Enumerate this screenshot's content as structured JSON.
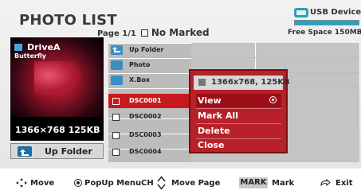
{
  "screen": {
    "title": "PHOTO LIST",
    "page_label": "Page 1/1",
    "marked_label": "No Marked"
  },
  "device": {
    "name": "USB Device",
    "free_space": "Free Space 150MB",
    "icon": "usb-drive-icon",
    "accent": "#1da5c4"
  },
  "preview": {
    "drive_name": "DriveA",
    "file_name": "Butterfly",
    "resolution_size": "1366×768  125KB"
  },
  "up_folder_button": {
    "label": "Up Folder",
    "icon": "up-folder-icon"
  },
  "file_list": {
    "items": [
      {
        "label": "Up Folder",
        "type": "folder-up",
        "icon": "up-folder-icon"
      },
      {
        "label": "Photo",
        "type": "folder",
        "icon": "folder-icon"
      },
      {
        "label": "X.Box",
        "type": "folder",
        "icon": "folder-icon"
      },
      {
        "label": "DSC0001",
        "type": "file",
        "icon": "checkbox-icon",
        "selected": true
      },
      {
        "label": "DSC0002",
        "type": "file",
        "icon": "checkbox-icon"
      },
      {
        "label": "DSC0003",
        "type": "file",
        "icon": "checkbox-icon"
      },
      {
        "label": "DSC0004",
        "type": "file",
        "icon": "checkbox-icon"
      }
    ],
    "selected_color": "#c8191c"
  },
  "popup": {
    "header": "1366x768, 125KB",
    "items": [
      {
        "label": "View",
        "active": true
      },
      {
        "label": "Mark All"
      },
      {
        "label": "Delete"
      },
      {
        "label": "Close"
      }
    ],
    "bg_color": "#b8202a"
  },
  "footer": {
    "move": "Move",
    "popup_menu": "PopUp Menu",
    "ch": "CH",
    "move_page": "Move Page",
    "mark_key": "MARK",
    "mark": "Mark",
    "exit": "Exit"
  }
}
